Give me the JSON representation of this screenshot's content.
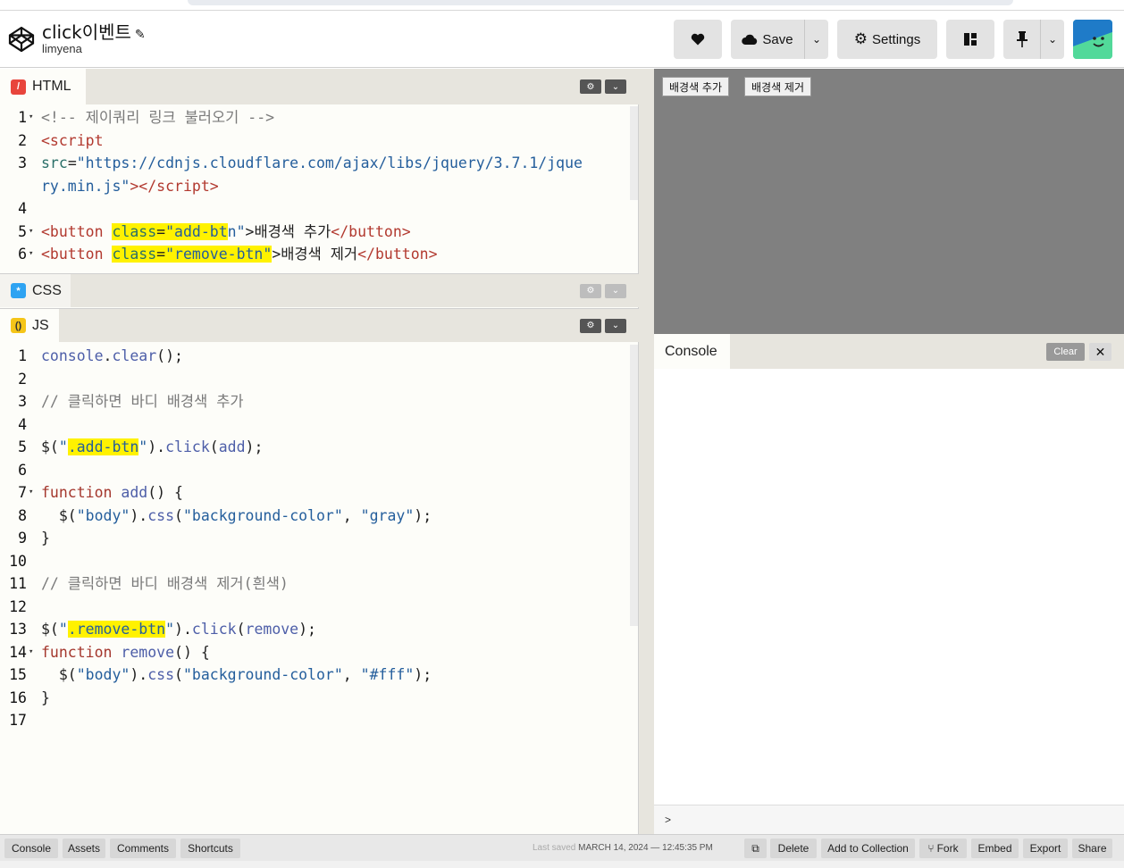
{
  "header": {
    "title": "click이벤트",
    "author": "limyena",
    "save_label": "Save",
    "settings_label": "Settings"
  },
  "panels": {
    "html_label": "HTML",
    "css_label": "CSS",
    "js_label": "JS"
  },
  "html_code": {
    "lines": [
      "1",
      "2",
      "3",
      "",
      "4",
      "5",
      "6"
    ]
  },
  "js_code": {
    "lines": [
      "1",
      "2",
      "3",
      "4",
      "5",
      "6",
      "7",
      "8",
      "9",
      "10",
      "11",
      "12",
      "13",
      "14",
      "15",
      "16",
      "17"
    ]
  },
  "preview": {
    "add_button": "배경색 추가",
    "remove_button": "배경색 제거"
  },
  "console": {
    "tab_label": "Console",
    "clear_label": "Clear",
    "prompt": ">"
  },
  "footer": {
    "console": "Console",
    "assets": "Assets",
    "comments": "Comments",
    "shortcuts": "Shortcuts",
    "last_saved_label": "Last saved",
    "last_saved_value": "MARCH 14, 2024 — 12:45:35 PM",
    "delete": "Delete",
    "add_to_collection": "Add to Collection",
    "fork": "Fork",
    "embed": "Embed",
    "export": "Export",
    "share": "Share"
  }
}
